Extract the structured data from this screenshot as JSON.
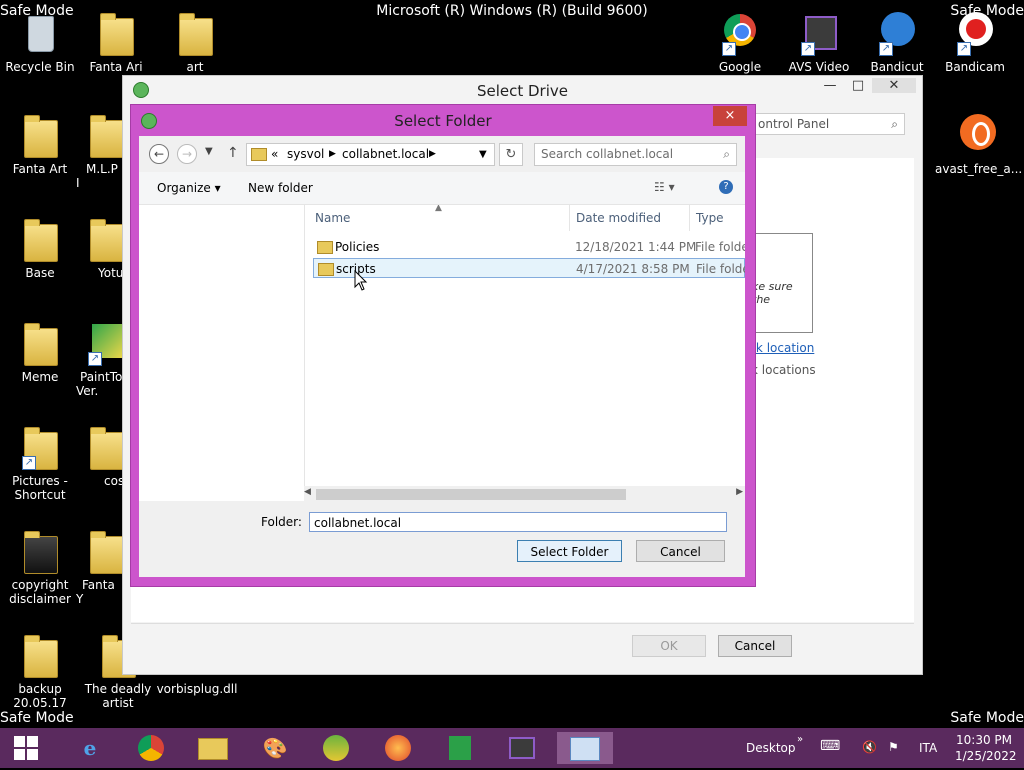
{
  "os": {
    "title": "Microsoft (R) Windows (R) (Build 9600)",
    "safe_mode": "Safe Mode"
  },
  "desktop_icons": [
    {
      "label": "Recycle Bin",
      "icon": "recycle-bin-icon"
    },
    {
      "label": "Fanta Ari",
      "icon": "folder-icon"
    },
    {
      "label": "art",
      "icon": "folder-icon"
    },
    {
      "label": "Google",
      "icon": "chrome-icon"
    },
    {
      "label": "AVS Video",
      "icon": "video-icon"
    },
    {
      "label": "Bandicut",
      "icon": "bandicut-icon"
    },
    {
      "label": "Bandicam",
      "icon": "bandicam-icon"
    },
    {
      "label": "Fanta Art",
      "icon": "folder-icon"
    },
    {
      "label": "M.L.P I",
      "icon": "folder-icon"
    },
    {
      "label": "avast_free_a...",
      "icon": "avast-icon"
    },
    {
      "label": "Base",
      "icon": "folder-icon"
    },
    {
      "label": "Yotu",
      "icon": "folder-icon"
    },
    {
      "label": "Meme",
      "icon": "folder-icon"
    },
    {
      "label": "PaintToo Ver.",
      "icon": "paint-icon"
    },
    {
      "label": "Pictures - Shortcut",
      "icon": "folder-icon"
    },
    {
      "label": "cos",
      "icon": "folder-icon"
    },
    {
      "label": "copyright disclaimer",
      "icon": "folder-icon"
    },
    {
      "label": "Fanta Y",
      "icon": "folder-icon"
    },
    {
      "label": "backup 20.05.17",
      "icon": "folder-icon"
    },
    {
      "label": "The deadly artist",
      "icon": "folder-icon"
    },
    {
      "label": "vorbisplug.dll",
      "icon": "dll-icon"
    }
  ],
  "select_drive": {
    "title": "Select Drive",
    "search_text": "ontrol Panel",
    "partial_text": "ke sure the",
    "link_text": "rk location",
    "link_text2": "k locations",
    "ok_label": "OK",
    "cancel_label": "Cancel"
  },
  "select_folder": {
    "title": "Select Folder",
    "close_label": "×",
    "breadcrumb": {
      "chevron": "«",
      "parts": [
        "sysvol",
        "collabnet.local"
      ]
    },
    "search_placeholder": "Search collabnet.local",
    "toolbar": {
      "organize": "Organize",
      "new_folder": "New folder"
    },
    "columns": [
      "Name",
      "Date modified",
      "Type"
    ],
    "rows": [
      {
        "name": "Policies",
        "date": "12/18/2021 1:44 PM",
        "type": "File folder"
      },
      {
        "name": "scripts",
        "date": "4/17/2021 8:58 PM",
        "type": "File folder"
      }
    ],
    "folder_label": "Folder:",
    "folder_value": "collabnet.local",
    "select_button": "Select Folder",
    "cancel_button": "Cancel"
  },
  "taskbar": {
    "desktop_label": "Desktop",
    "lang": "ITA",
    "time": "10:30 PM",
    "date": "1/25/2022"
  }
}
